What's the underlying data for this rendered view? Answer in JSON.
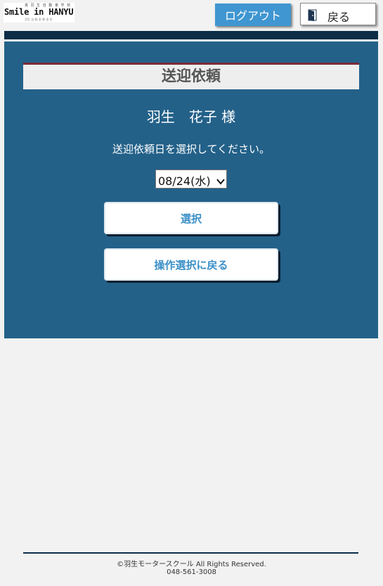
{
  "header": {
    "logo_top": "真 羽 生 自 動 車 学 校",
    "logo_main": "Smile in HANYU",
    "logo_bottom": "羽生 自 動 車 教 習 所",
    "logout_label": "ログアウト",
    "back_label": "戻る"
  },
  "panel": {
    "title": "送迎依頼",
    "user_name": "羽生　花子 様",
    "instruction": "送迎依頼日を選択してください。",
    "date_select": {
      "selected": "08/24(水)"
    },
    "select_button": "選択",
    "return_button": "操作選択に戻る"
  },
  "footer": {
    "copyright": "©羽生モータースクール All Rights Reserved.",
    "phone": "048-561-3008"
  },
  "colors": {
    "panel_bg": "#236189",
    "dark_bar": "#0d2d47",
    "accent_blue": "#3f96d1",
    "title_border": "#7a2a36"
  }
}
